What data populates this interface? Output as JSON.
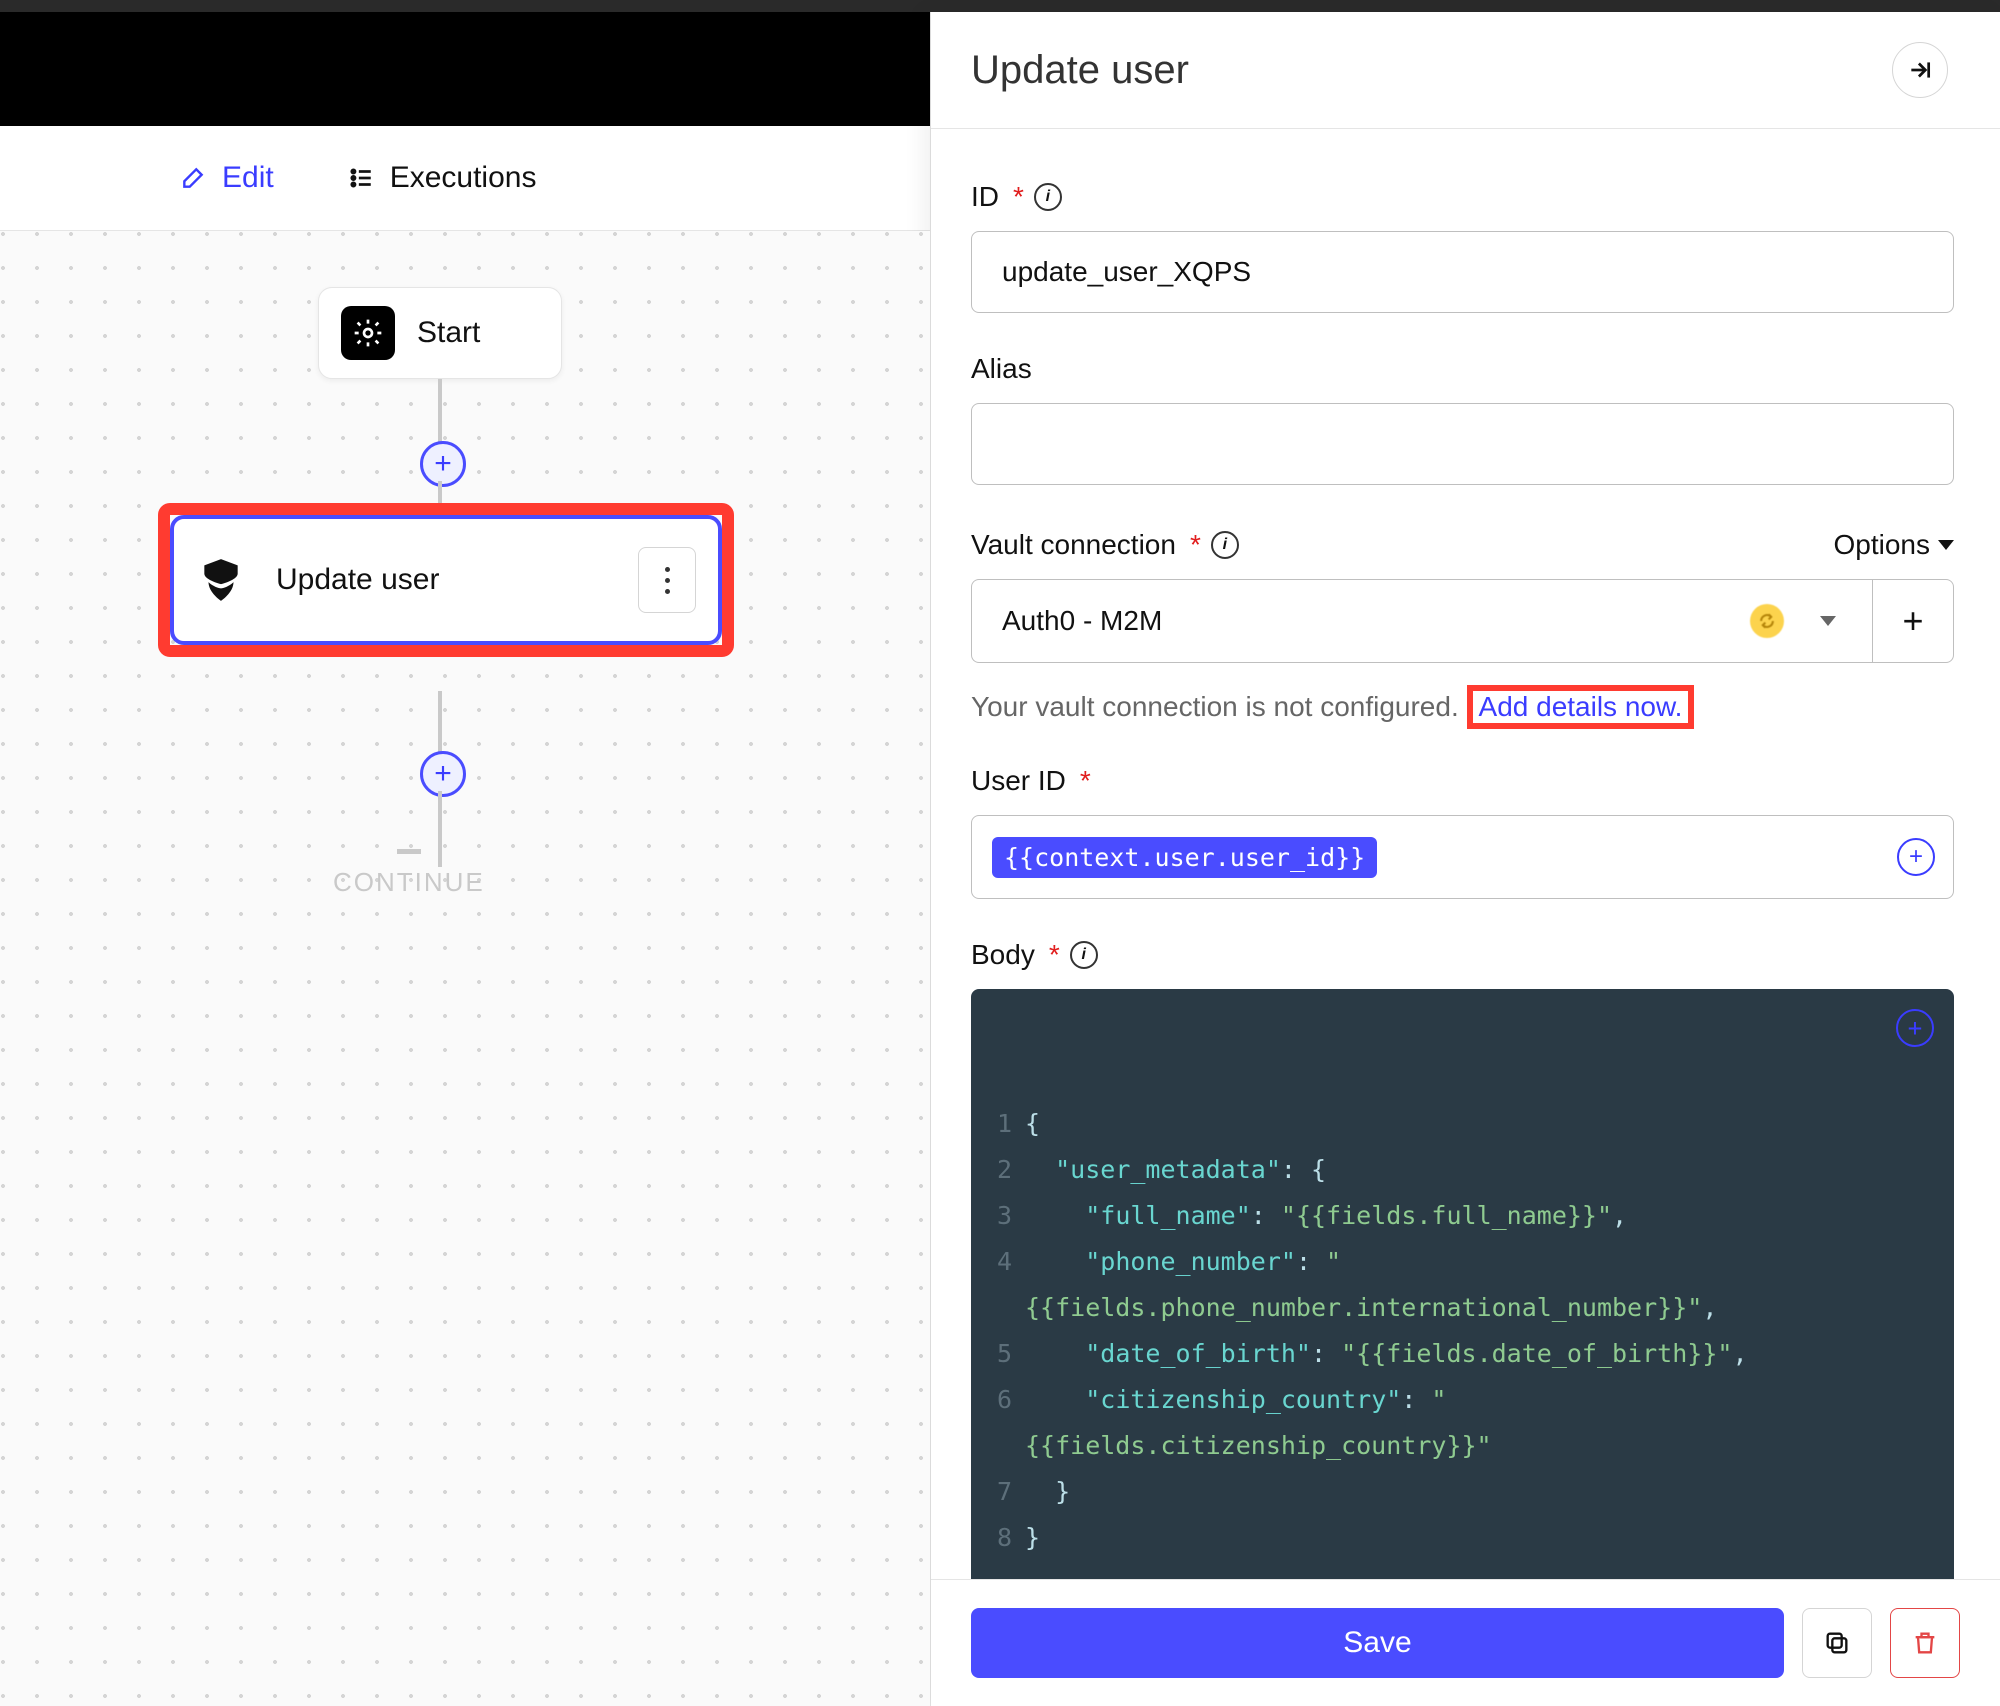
{
  "tabs": {
    "edit": "Edit",
    "executions": "Executions"
  },
  "nodes": {
    "start": "Start",
    "update_user": "Update user",
    "continue": "CONTINUE"
  },
  "panel": {
    "title": "Update user",
    "id_label": "ID",
    "id_value": "update_user_XQPS",
    "alias_label": "Alias",
    "alias_value": "",
    "vault_label": "Vault connection",
    "options_label": "Options",
    "vault_value": "Auth0 - M2M",
    "vault_helper": "Your vault connection is not configured.",
    "vault_link": "Add details now.",
    "user_id_label": "User ID",
    "user_id_pill": "{{context.user.user_id}}",
    "body_label": "Body",
    "body_lines": [
      {
        "n": "1",
        "segs": [
          {
            "t": "{",
            "c": "p"
          }
        ]
      },
      {
        "n": "2",
        "segs": [
          {
            "t": "  ",
            "c": "p"
          },
          {
            "t": "\"user_metadata\"",
            "c": "k"
          },
          {
            "t": ": {",
            "c": "p"
          }
        ]
      },
      {
        "n": "3",
        "segs": [
          {
            "t": "    ",
            "c": "p"
          },
          {
            "t": "\"full_name\"",
            "c": "k"
          },
          {
            "t": ": ",
            "c": "p"
          },
          {
            "t": "\"{{fields.full_name}}\"",
            "c": "s"
          },
          {
            "t": ",",
            "c": "p"
          }
        ]
      },
      {
        "n": "4",
        "segs": [
          {
            "t": "    ",
            "c": "p"
          },
          {
            "t": "\"phone_number\"",
            "c": "k"
          },
          {
            "t": ": ",
            "c": "p"
          },
          {
            "t": "\"",
            "c": "s"
          }
        ]
      },
      {
        "n": "",
        "segs": [
          {
            "t": "{{fields.phone_number.international_number}}\"",
            "c": "s"
          },
          {
            "t": ",",
            "c": "p"
          }
        ]
      },
      {
        "n": "5",
        "segs": [
          {
            "t": "    ",
            "c": "p"
          },
          {
            "t": "\"date_of_birth\"",
            "c": "k"
          },
          {
            "t": ": ",
            "c": "p"
          },
          {
            "t": "\"{{fields.date_of_birth}}\"",
            "c": "s"
          },
          {
            "t": ",",
            "c": "p"
          }
        ]
      },
      {
        "n": "6",
        "segs": [
          {
            "t": "    ",
            "c": "p"
          },
          {
            "t": "\"citizenship_country\"",
            "c": "k"
          },
          {
            "t": ": ",
            "c": "p"
          },
          {
            "t": "\"",
            "c": "s"
          }
        ]
      },
      {
        "n": "",
        "segs": [
          {
            "t": "{{fields.citizenship_country}}\"",
            "c": "s"
          }
        ]
      },
      {
        "n": "7",
        "segs": [
          {
            "t": "  }",
            "c": "p"
          }
        ]
      },
      {
        "n": "8",
        "segs": [
          {
            "t": "}",
            "c": "p"
          }
        ]
      }
    ],
    "save": "Save"
  }
}
